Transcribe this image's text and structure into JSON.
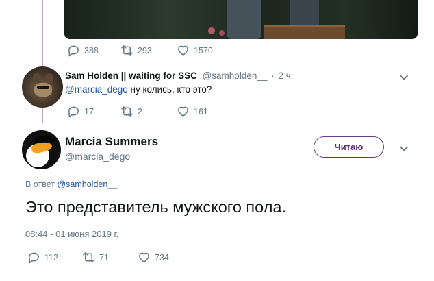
{
  "prev_tweet": {
    "replies": "388",
    "retweets": "293",
    "likes": "1570"
  },
  "reply_tweet": {
    "display_name": "Sam Holden || waiting for SSC",
    "handle": "@samholden__",
    "separator": "·",
    "time": "2 ч.",
    "mention": "@marcia_dego",
    "text": " ну колись, кто это?",
    "replies": "17",
    "retweets": "2",
    "likes": "161"
  },
  "main_tweet": {
    "display_name": "Marcia Summers",
    "handle": "@marcia_dego",
    "follow_label": "Читаю",
    "reply_prefix": "В ответ ",
    "reply_to": "@samholden__",
    "text": "Это представитель мужского пола.",
    "timestamp": "08:44 - 01 июня 2019 г.",
    "replies": "112",
    "retweets": "71",
    "likes": "734"
  },
  "colors": {
    "accent_link": "#1d54a6",
    "follow_border": "#6b3b8c",
    "thread_line": "#c4a3c8",
    "muted": "#657786"
  },
  "icons": [
    "reply-icon",
    "retweet-icon",
    "like-icon",
    "chevron-down-icon"
  ]
}
